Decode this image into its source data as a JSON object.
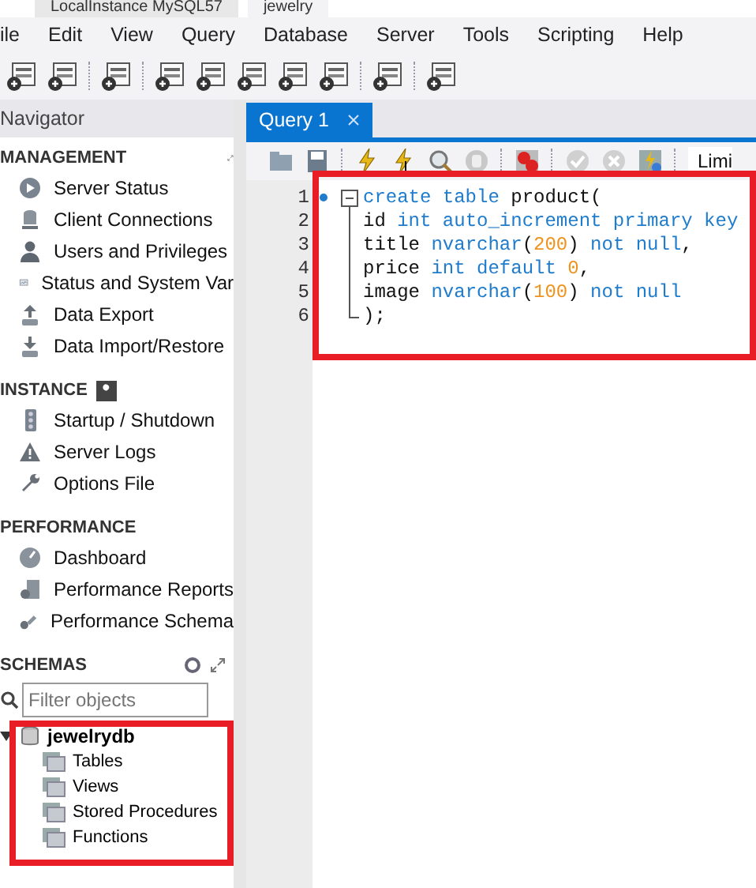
{
  "window_tabs": [
    {
      "label": "LocalInstance MySQL57",
      "selected": false
    },
    {
      "label": "jewelry",
      "selected": true
    }
  ],
  "menu": [
    "ile",
    "Edit",
    "View",
    "Query",
    "Database",
    "Server",
    "Tools",
    "Scripting",
    "Help"
  ],
  "navigator": {
    "title": "Navigator",
    "sections": [
      {
        "title": "MANAGEMENT",
        "items": [
          "Server Status",
          "Client Connections",
          "Users and Privileges",
          "Status and System Var",
          "Data Export",
          "Data Import/Restore"
        ]
      },
      {
        "title": "INSTANCE",
        "items": [
          "Startup / Shutdown",
          "Server Logs",
          "Options File"
        ]
      },
      {
        "title": "PERFORMANCE",
        "items": [
          "Dashboard",
          "Performance Reports",
          "Performance Schema"
        ]
      }
    ],
    "schemas": {
      "title": "SCHEMAS",
      "filter": {
        "placeholder": "Filter objects"
      },
      "highlighted": true,
      "tree": [
        {
          "label": "jewelrydb",
          "expanded": true,
          "children": [
            {
              "label": "Tables"
            },
            {
              "label": "Views"
            },
            {
              "label": "Stored Procedures"
            },
            {
              "label": "Functions"
            }
          ]
        }
      ]
    }
  },
  "editor": {
    "tabs": [
      {
        "label": "Query 1",
        "selected": true
      }
    ],
    "limit_label": "Limi",
    "highlighted": true,
    "lines": [
      {
        "number": "1",
        "tokens": [
          {
            "text": "create table ",
            "kind": "keyword"
          },
          {
            "text": "product(",
            "kind": "plain"
          }
        ]
      },
      {
        "number": "2",
        "tokens": [
          {
            "text": "id ",
            "kind": "plain"
          },
          {
            "text": "int auto_increment primary key",
            "kind": "keyword"
          }
        ]
      },
      {
        "number": "3",
        "tokens": [
          {
            "text": "title ",
            "kind": "plain"
          },
          {
            "text": "nvarchar",
            "kind": "keyword"
          },
          {
            "text": "(",
            "kind": "plain"
          },
          {
            "text": "200",
            "kind": "number"
          },
          {
            "text": ") ",
            "kind": "plain"
          },
          {
            "text": "not null",
            "kind": "keyword"
          },
          {
            "text": ",",
            "kind": "plain"
          }
        ]
      },
      {
        "number": "4",
        "tokens": [
          {
            "text": "price ",
            "kind": "plain"
          },
          {
            "text": "int default ",
            "kind": "keyword"
          },
          {
            "text": "0",
            "kind": "number"
          },
          {
            "text": ",",
            "kind": "plain"
          }
        ]
      },
      {
        "number": "5",
        "tokens": [
          {
            "text": "image ",
            "kind": "plain"
          },
          {
            "text": "nvarchar",
            "kind": "keyword"
          },
          {
            "text": "(",
            "kind": "plain"
          },
          {
            "text": "100",
            "kind": "number"
          },
          {
            "text": ") ",
            "kind": "plain"
          },
          {
            "text": "not null",
            "kind": "keyword"
          }
        ]
      },
      {
        "number": "6",
        "tokens": [
          {
            "text": ");",
            "kind": "plain"
          }
        ]
      }
    ]
  }
}
